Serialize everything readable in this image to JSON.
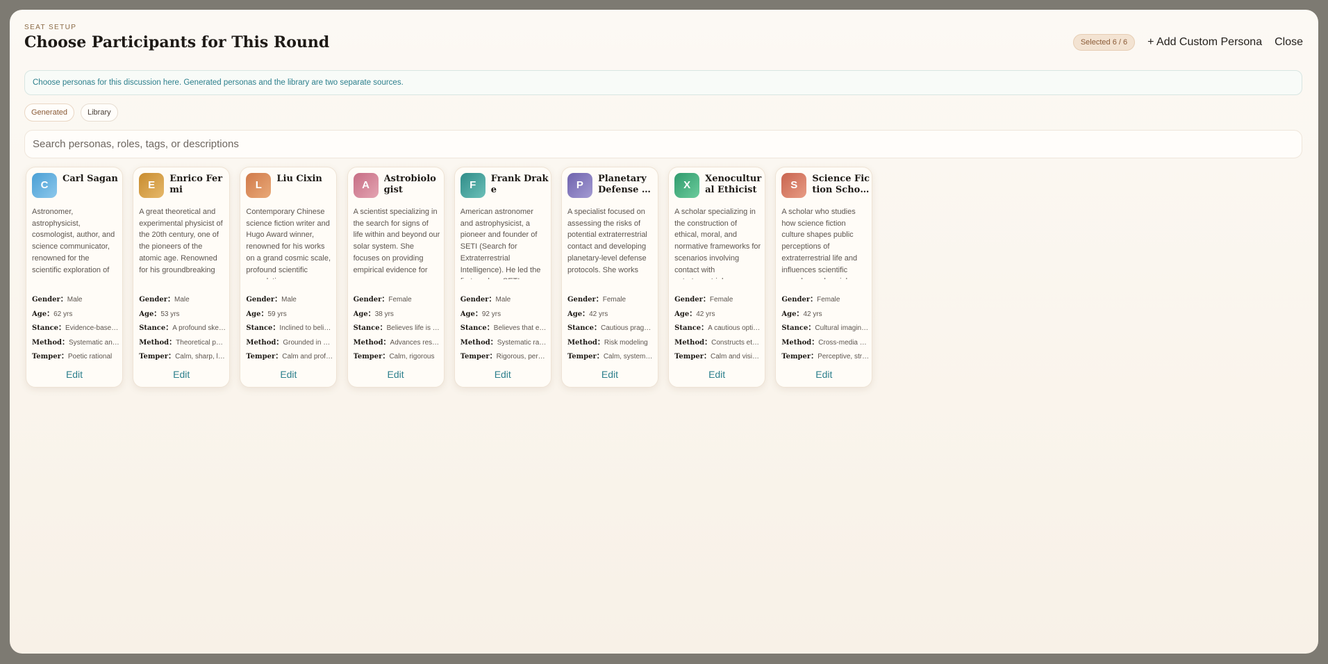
{
  "header": {
    "eyebrow": "SEAT SETUP",
    "title": "Choose Participants for This Round",
    "selected_badge": "Selected 6 / 6",
    "add_custom_label": "+ Add Custom Persona",
    "close_label": "Close"
  },
  "info_text": "Choose personas for this discussion here. Generated personas and the library are two separate sources.",
  "tabs": [
    {
      "label": "Generated"
    },
    {
      "label": "Library"
    }
  ],
  "search": {
    "placeholder": "Search personas, roles, tags, or descriptions"
  },
  "attr_labels": {
    "gender": "Gender：",
    "age": "Age：",
    "stance": "Stance：",
    "method": "Method：",
    "temper": "Temper："
  },
  "edit_label": "Edit",
  "personas": [
    {
      "initial": "C",
      "name": "Carl Sagan",
      "color": [
        "#4a9fd4",
        "#8cc8ec"
      ],
      "desc": "Astronomer, astrophysicist, cosmologist, author, and science communicator, renowned for the scientific exploration of",
      "gender": "Male",
      "age": "62 yrs",
      "stance": "Evidence-based optimism",
      "method": "Systematic analysis",
      "temper": "Poetic rational"
    },
    {
      "initial": "E",
      "name": "Enrico Fermi",
      "color": [
        "#c88c2f",
        "#e6b86a"
      ],
      "desc": "A great theoretical and experimental physicist of the 20th century, one of the pioneers of the atomic age. Renowned for his groundbreaking",
      "gender": "Male",
      "age": "53 yrs",
      "stance": "A profound skeptic",
      "method": "Theoretical physics",
      "temper": "Calm, sharp, logical"
    },
    {
      "initial": "L",
      "name": "Liu Cixin",
      "color": [
        "#d07a4a",
        "#e9a978"
      ],
      "desc": "Contemporary Chinese science fiction writer and Hugo Award winner, renowned for his works on a grand cosmic scale, profound scientific speculation",
      "gender": "Male",
      "age": "59 yrs",
      "stance": "Inclined to believe",
      "method": "Grounded in physics",
      "temper": "Calm and profound"
    },
    {
      "initial": "A",
      "name": "Astrobiologist",
      "color": [
        "#c66d84",
        "#e4a4b2"
      ],
      "desc": "A scientist specializing in the search for signs of life within and beyond our solar system. She focuses on providing empirical evidence for",
      "gender": "Female",
      "age": "38 yrs",
      "stance": "Believes life is common",
      "method": "Advances research",
      "temper": "Calm, rigorous"
    },
    {
      "initial": "F",
      "name": "Frank Drake",
      "color": [
        "#2f8c88",
        "#6cc0b8"
      ],
      "desc": "American astronomer and astrophysicist, a pioneer and founder of SETI (Search for Extraterrestrial Intelligence). He led the first modern SETI",
      "gender": "Male",
      "age": "92 yrs",
      "stance": "Believes that extraterrestrial life",
      "method": "Systematic radio search",
      "temper": "Rigorous, persistent"
    },
    {
      "initial": "P",
      "name": "Planetary Defense Specialist",
      "color": [
        "#6f63ad",
        "#a39ad2"
      ],
      "desc": "A specialist focused on assessing the risks of potential extraterrestrial contact and developing planetary-level defense protocols. She works",
      "gender": "Female",
      "age": "42 yrs",
      "stance": "Cautious pragmatist",
      "method": "Risk modeling",
      "temper": "Calm, systematic"
    },
    {
      "initial": "X",
      "name": "Xenocultural Ethicist",
      "color": [
        "#2f9a6c",
        "#6ccc9c"
      ],
      "desc": "A scholar specializing in the construction of ethical, moral, and normative frameworks for scenarios involving contact with extraterrestrial",
      "gender": "Female",
      "age": "42 yrs",
      "stance": "A cautious optimist",
      "method": "Constructs ethical",
      "temper": "Calm and visionary"
    },
    {
      "initial": "S",
      "name": "Science Fiction Scholar",
      "color": [
        "#c8644f",
        "#e89c84"
      ],
      "desc": "A scholar who studies how science fiction culture shapes public perceptions of extraterrestrial life and influences scientific agendas and social",
      "gender": "Female",
      "age": "42 yrs",
      "stance": "Cultural imagination",
      "method": "Cross-media analysis",
      "temper": "Perceptive, strategic"
    }
  ]
}
